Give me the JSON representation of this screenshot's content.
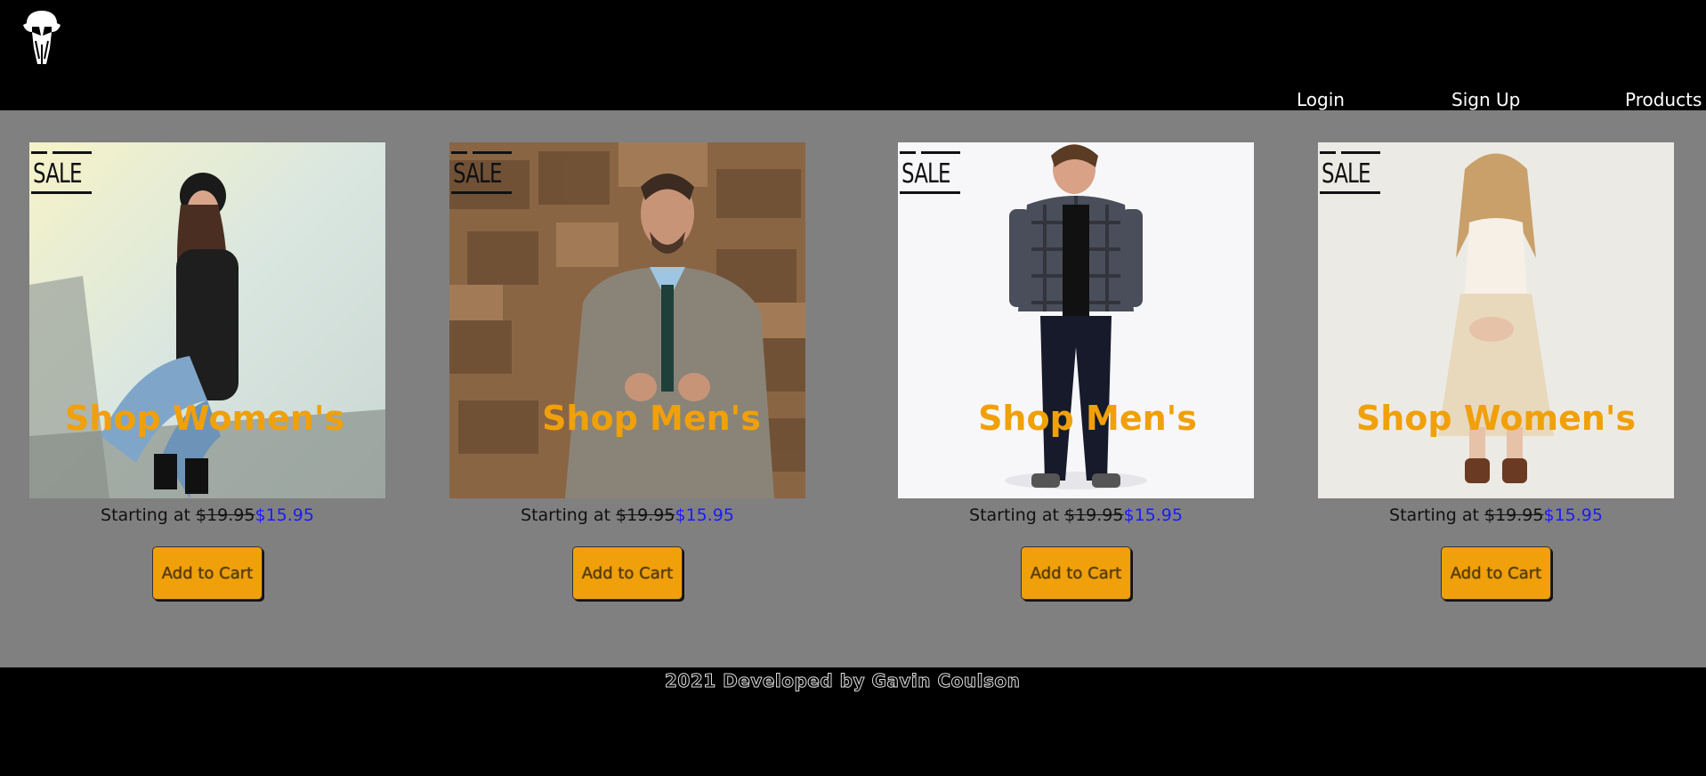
{
  "header": {
    "logo_icon": "mandalorian-skull-icon",
    "nav": {
      "login": "Login",
      "signup": "Sign Up",
      "products": "Products"
    }
  },
  "products": [
    {
      "badge": "SALE",
      "label": "Shop Women's",
      "price_prefix": "Starting at ",
      "old_price": "$19.95",
      "new_price": "$15.95",
      "button": "Add to Cart"
    },
    {
      "badge": "SALE",
      "label": "Shop Men's",
      "price_prefix": "Starting at ",
      "old_price": "$19.95",
      "new_price": "$15.95",
      "button": "Add to Cart"
    },
    {
      "badge": "SALE",
      "label": "Shop Men's",
      "price_prefix": "Starting at ",
      "old_price": "$19.95",
      "new_price": "$15.95",
      "button": "Add to Cart"
    },
    {
      "badge": "SALE",
      "label": "Shop Women's",
      "price_prefix": "Starting at ",
      "old_price": "$19.95",
      "new_price": "$15.95",
      "button": "Add to Cart"
    }
  ],
  "footer": {
    "text": "2021 Developed by Gavin Coulson"
  },
  "colors": {
    "accent": "#f0a00a",
    "sale_price": "#1a1aff",
    "main_bg": "#808080",
    "header_bg": "#000000"
  }
}
